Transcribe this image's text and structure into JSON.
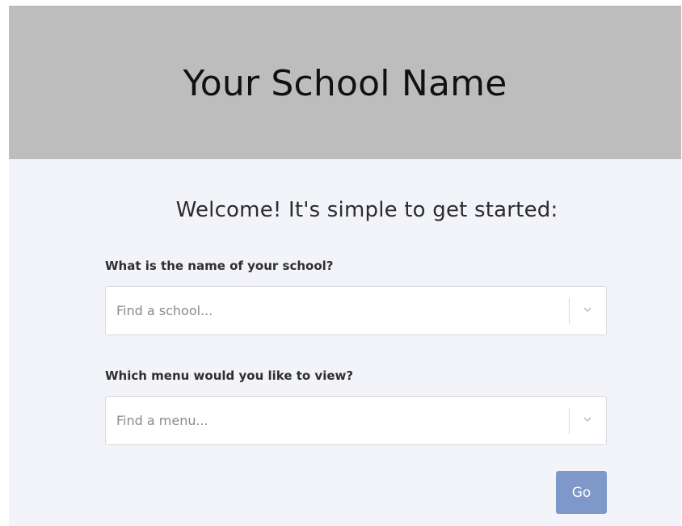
{
  "header": {
    "title": "Your School Name"
  },
  "main": {
    "welcome": "Welcome! It's simple to get started:",
    "school_field": {
      "label": "What is the name of your school?",
      "placeholder": "Find a school..."
    },
    "menu_field": {
      "label": "Which menu would you like to view?",
      "placeholder": "Find a menu..."
    },
    "go_label": "Go"
  },
  "icons": {
    "dropdown": "chevron-down-icon"
  },
  "colors": {
    "header_bg": "#bdbdbd",
    "content_bg": "#f3f4f9",
    "button_bg": "#7e98c9",
    "button_text": "#ffffff"
  }
}
